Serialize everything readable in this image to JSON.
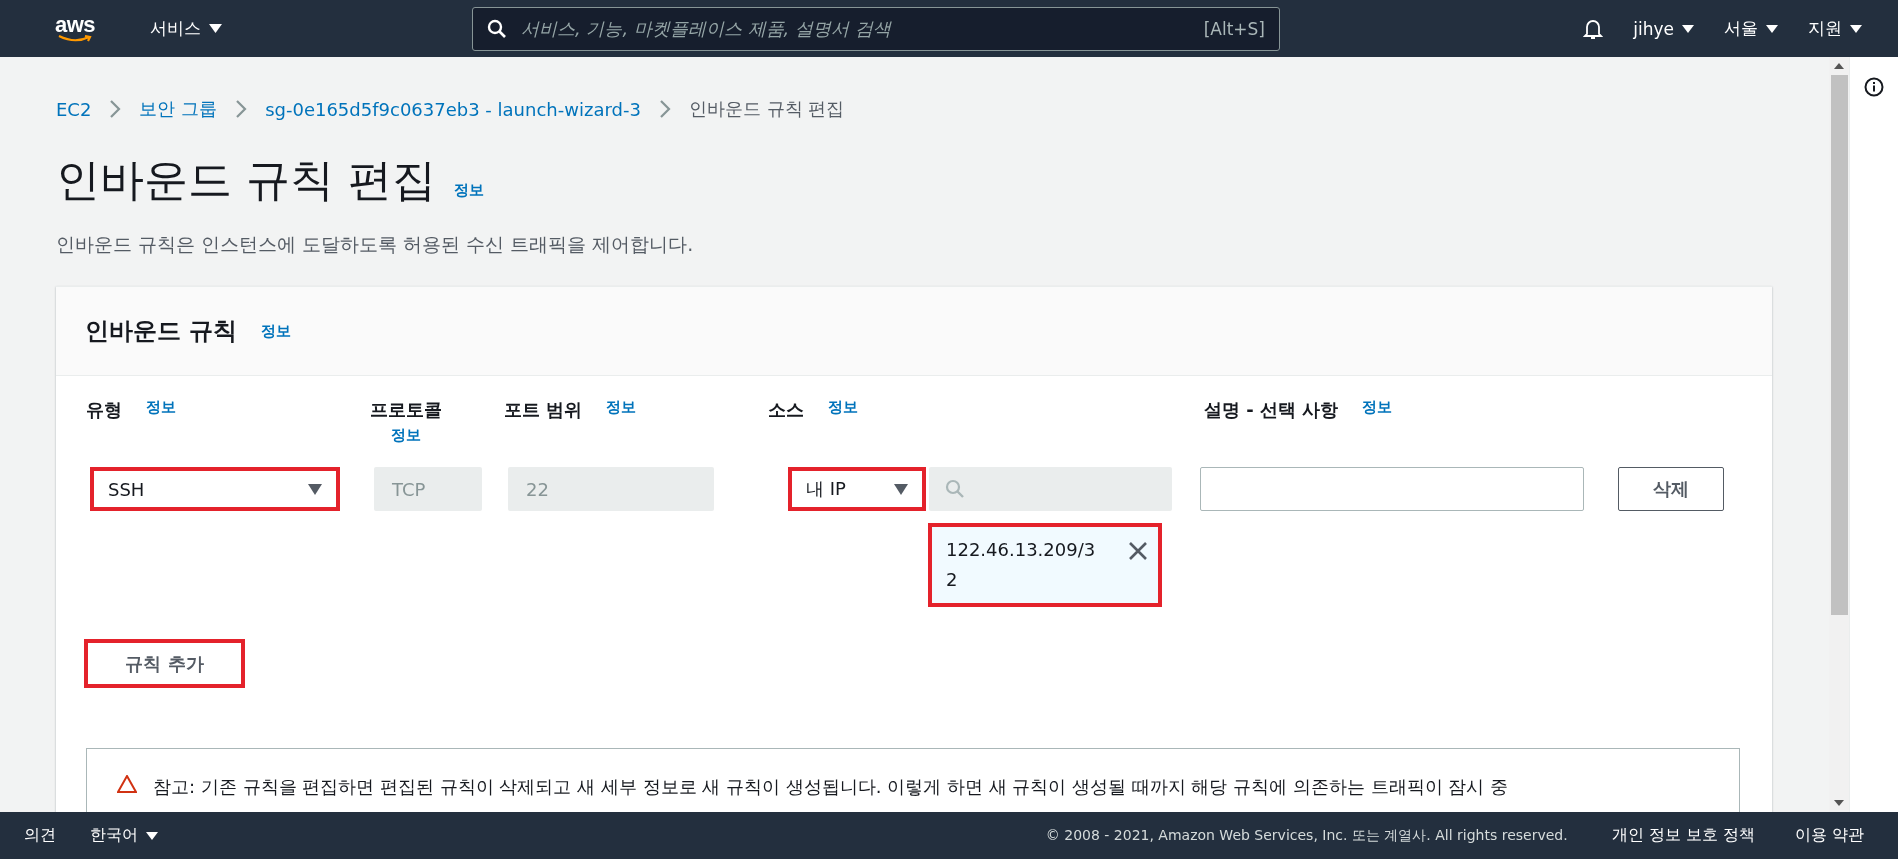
{
  "top_bar": {
    "logo": "aws",
    "services_menu": "서비스",
    "search": {
      "placeholder": "서비스, 기능, 마켓플레이스 제품, 설명서 검색",
      "shortcut": "[Alt+S]"
    },
    "user_menu": "jihye",
    "region_menu": "서울",
    "support_menu": "지원"
  },
  "breadcrumbs": [
    {
      "label": "EC2",
      "link": true
    },
    {
      "label": "보안 그룹",
      "link": true
    },
    {
      "label": "sg-0e165d5f9c0637eb3 - launch-wizard-3",
      "link": true
    },
    {
      "label": "인바운드 규칙 편집",
      "link": false
    }
  ],
  "page": {
    "title": "인바운드 규칙 편집",
    "info": "정보",
    "description": "인바운드 규칙은 인스턴스에 도달하도록 허용된 수신 트래픽을 제어합니다."
  },
  "panel": {
    "title": "인바운드 규칙",
    "info": "정보",
    "columns": [
      {
        "label": "유형",
        "info": "정보"
      },
      {
        "label": "프로토콜",
        "info": "정보"
      },
      {
        "label": "포트 범위",
        "info": "정보"
      },
      {
        "label": "소스",
        "info": "정보"
      },
      {
        "label": "설명 - 선택 사항",
        "info": "정보"
      }
    ],
    "rules": [
      {
        "type": {
          "value": "SSH",
          "highlighted": true
        },
        "protocol": "TCP",
        "port_range": "22",
        "source": {
          "value": "내 IP",
          "highlighted": true
        },
        "cidr_token": {
          "value": "122.46.13.209/32",
          "highlighted": true
        },
        "delete_button": "삭제"
      }
    ],
    "add_rule_button": {
      "label": "규칙 추가",
      "highlighted": true
    },
    "warning": "참고: 기존 규칙을 편집하면 편집된 규칙이 삭제되고 새 세부 정보로 새 규칙이 생성됩니다. 이렇게 하면 새 규칙이 생성될 때까지 해당 규칙에 의존하는 트래픽이 잠시 중"
  },
  "footer": {
    "feedback": "의견",
    "language": "한국어",
    "copyright": "© 2008 - 2021, Amazon Web Services, Inc. 또는 계열사. All rights reserved.",
    "links": [
      "개인 정보 보호 정책",
      "이용 약관"
    ]
  }
}
